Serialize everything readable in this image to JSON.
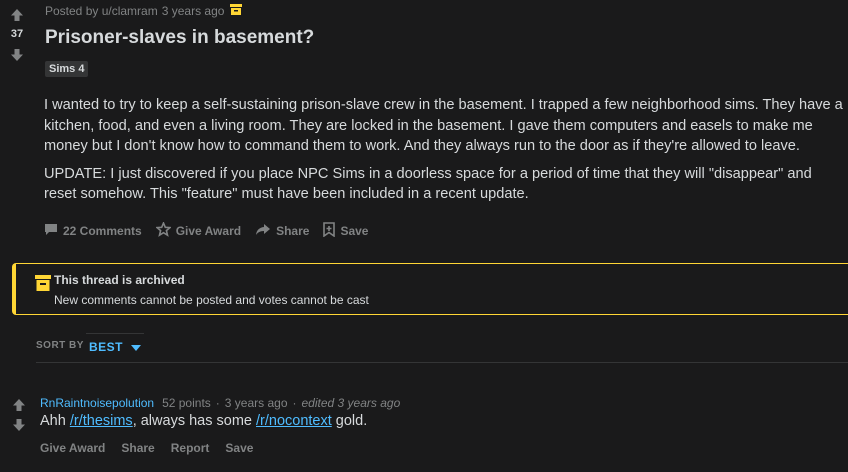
{
  "post": {
    "score": "37",
    "posted_by": "Posted by u/clamram",
    "time": "3 years ago",
    "title": "Prisoner-slaves in basement?",
    "flair": "Sims 4",
    "body": [
      "I wanted to try to keep a self-sustaining prison-slave crew in the basement. I trapped a few neighborhood sims. They have a kitchen, food, and even a living room. They are locked in the basement. I gave them computers and easels to make me money but I don't know how to command them to work. And they always run to the door as if they're allowed to leave.",
      "UPDATE: I just discovered if you place NPC Sims in a doorless space for a period of time that they will \"disappear\" and reset somehow. This \"feature\" must have been included in a recent update."
    ],
    "actions": {
      "comments": "22 Comments",
      "give_award": "Give Award",
      "share": "Share",
      "save": "Save"
    }
  },
  "archived": {
    "title": "This thread is archived",
    "subtitle": "New comments cannot be posted and votes cannot be cast",
    "color": "#ffd635"
  },
  "sort": {
    "label": "SORT BY",
    "value": "BEST"
  },
  "comment": {
    "author": "RnRaintnoisepolution",
    "points": "52 points",
    "sep1": "·",
    "time": "3 years ago",
    "sep2": "·",
    "edited": "edited 3 years ago",
    "text_before": "Ahh ",
    "link1": "/r/thesims",
    "text_middle": ", always has some ",
    "link2": "/r/nocontext",
    "text_after": " gold.",
    "actions": {
      "give_award": "Give Award",
      "share": "Share",
      "report": "Report",
      "save": "Save"
    }
  },
  "colors": {
    "background": "#1a1a1b",
    "text": "#d7dadc",
    "muted": "#818384",
    "link": "#4fbcff",
    "archived_accent": "#ffd635"
  }
}
